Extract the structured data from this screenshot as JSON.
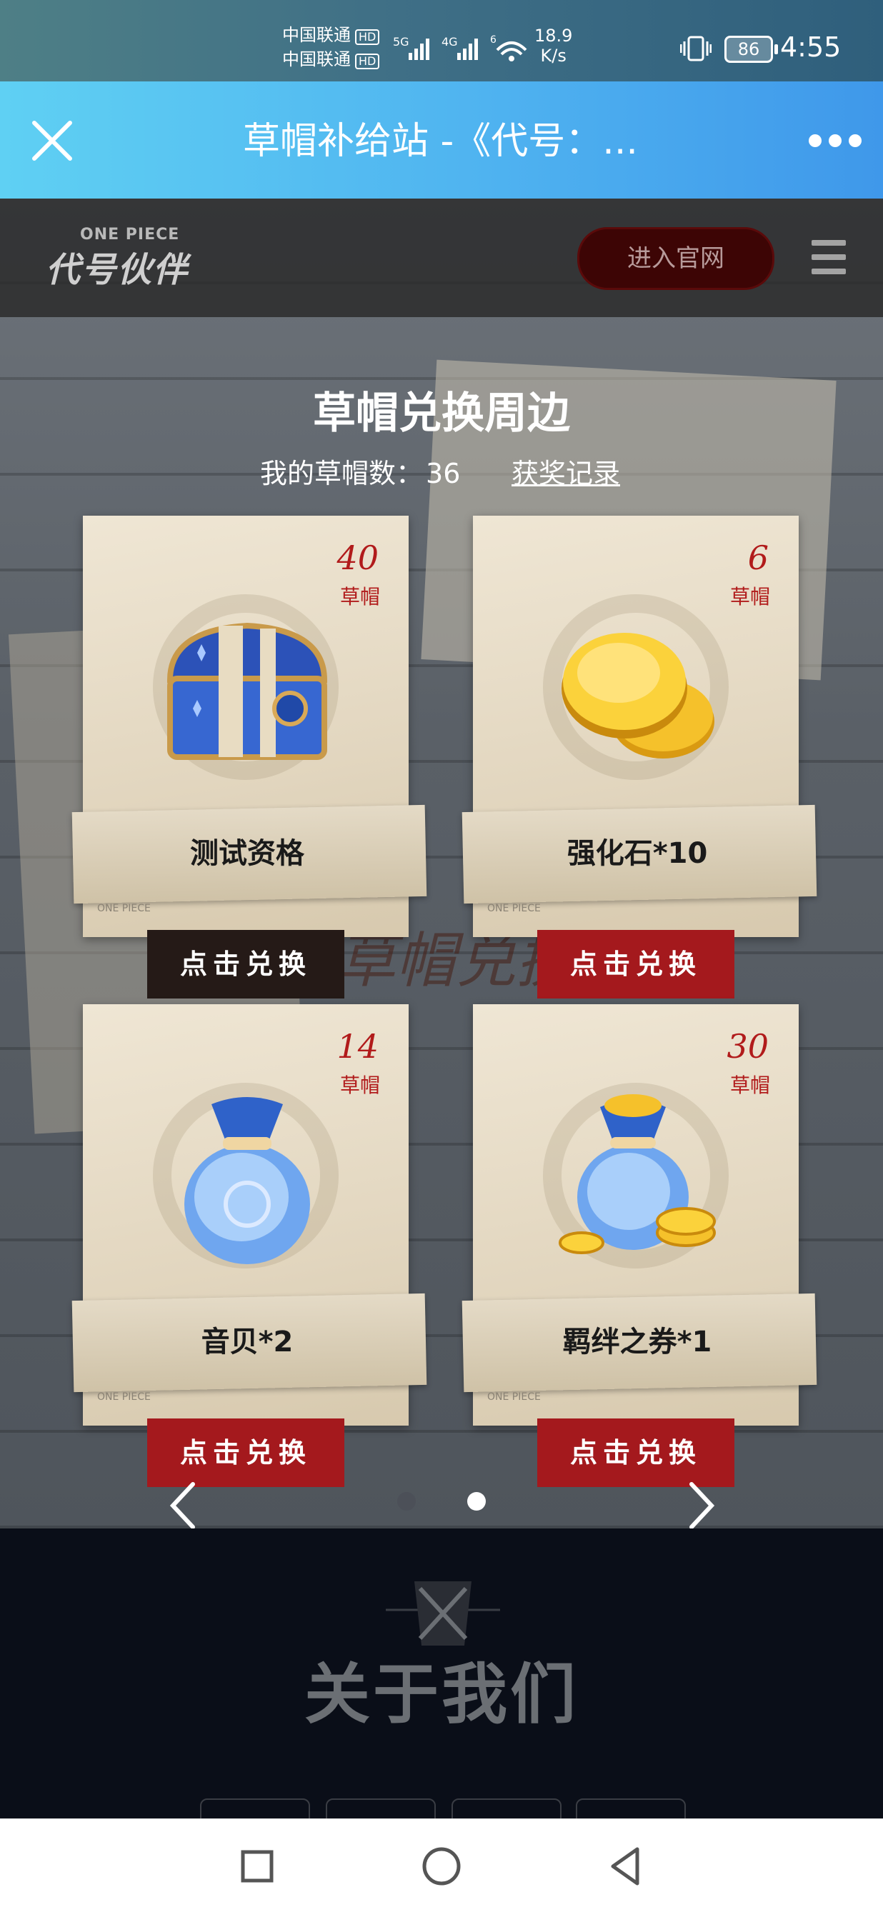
{
  "status_bar": {
    "carrier1": "中国联通",
    "carrier2": "中国联通",
    "hd": "HD",
    "net1": "5G",
    "net2": "4G",
    "wifi_gen": "6",
    "speed_value": "18.9",
    "speed_unit": "K/s",
    "battery": "86",
    "time": "4:55"
  },
  "app_bar": {
    "title": "草帽补给站 -《代号：..."
  },
  "site_header": {
    "logo_small": "ONE PIECE",
    "logo": "代号伙伴",
    "official_button": "进入官网"
  },
  "exchange": {
    "title": "草帽兑换周边",
    "hats_label": "我的草帽数：",
    "hats_count": "36",
    "record_link": "获奖记录",
    "background_text": "草帽兑换",
    "items": [
      {
        "cost": "40",
        "unit": "草帽",
        "name": "测试资格",
        "button": "点击兑换",
        "watermark": "ONE PIECE"
      },
      {
        "cost": "6",
        "unit": "草帽",
        "name": "强化石*10",
        "button": "点击兑换",
        "watermark": "ONE PIECE"
      },
      {
        "cost": "14",
        "unit": "草帽",
        "name": "音贝*2",
        "button": "点击兑换",
        "watermark": "ONE PIECE"
      },
      {
        "cost": "30",
        "unit": "草帽",
        "name": "羁绊之券*1",
        "button": "点击兑换",
        "watermark": "ONE PIECE"
      }
    ]
  },
  "carousel": {
    "page_count": 2,
    "active_page": 2
  },
  "footer": {
    "about_title": "关于我们"
  },
  "colors": {
    "app_bar_start": "#5fd0f3",
    "app_bar_end": "#3f98ea",
    "redeem_button": "#a4191d",
    "redeem_button_disabled": "#251a17",
    "cost_red": "#b11b1b"
  },
  "icons": [
    "close-icon",
    "more-icon",
    "menu-icon",
    "treasure-chest-icon",
    "gold-coins-icon",
    "blue-pouch-icon",
    "coin-pouch-icon",
    "chevron-left-icon",
    "chevron-right-icon",
    "square-nav-icon",
    "circle-nav-icon",
    "back-triangle-icon"
  ]
}
